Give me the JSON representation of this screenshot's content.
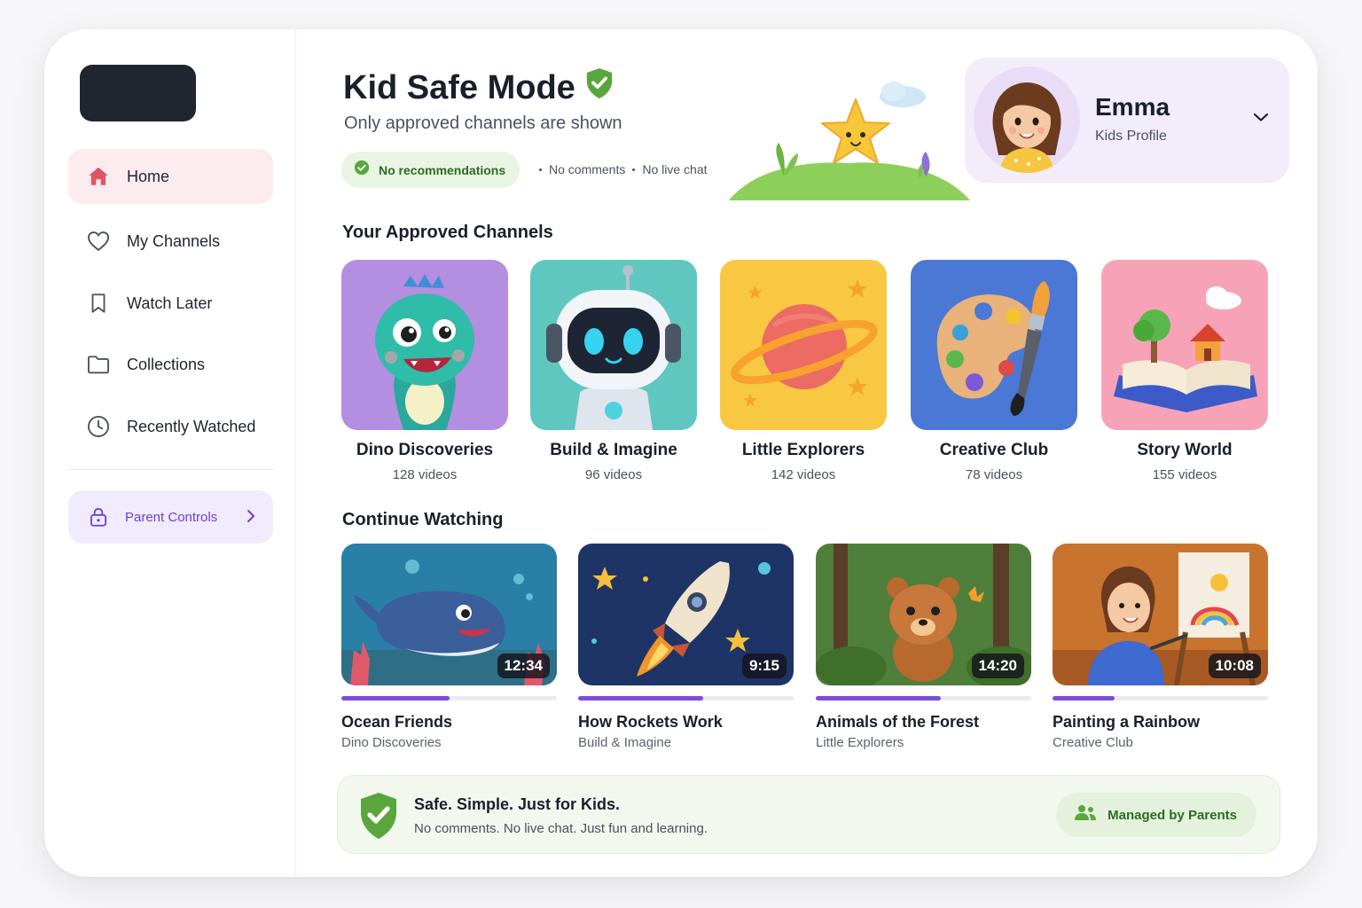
{
  "sidebar": {
    "items": [
      {
        "label": "Home",
        "icon": "home-icon"
      },
      {
        "label": "My Channels",
        "icon": "heart-icon"
      },
      {
        "label": "Watch Later",
        "icon": "bookmark-icon"
      },
      {
        "label": "Collections",
        "icon": "folder-icon"
      },
      {
        "label": "Recently Watched",
        "icon": "clock-icon"
      }
    ],
    "parent_controls_label": "Parent Controls"
  },
  "header": {
    "title": "Kid Safe Mode",
    "subtitle": "Only approved channels are shown",
    "chip_label": "No recommendations",
    "extra_1": "No comments",
    "extra_2": "No live chat"
  },
  "profile": {
    "name": "Emma",
    "type": "Kids Profile"
  },
  "channels": {
    "title": "Your Approved Channels",
    "items": [
      {
        "name": "Dino Discoveries",
        "count": "128 videos",
        "color": "#b48ee0"
      },
      {
        "name": "Build & Imagine",
        "count": "96 videos",
        "color": "#5fc7c0"
      },
      {
        "name": "Little Explorers",
        "count": "142 videos",
        "color": "#f8c842"
      },
      {
        "name": "Creative Club",
        "count": "78 videos",
        "color": "#4a78d4"
      },
      {
        "name": "Story World",
        "count": "155 videos",
        "color": "#f6a3b8"
      }
    ]
  },
  "continue": {
    "title": "Continue Watching",
    "items": [
      {
        "title": "Ocean Friends",
        "channel": "Dino Discoveries",
        "duration": "12:34",
        "progress": 0.5
      },
      {
        "title": "How Rockets Work",
        "channel": "Build & Imagine",
        "duration": "9:15",
        "progress": 0.58
      },
      {
        "title": "Animals of the Forest",
        "channel": "Little Explorers",
        "duration": "14:20",
        "progress": 0.58
      },
      {
        "title": "Painting a Rainbow",
        "channel": "Creative Club",
        "duration": "10:08",
        "progress": 0.29
      }
    ]
  },
  "banner": {
    "title": "Safe. Simple. Just for Kids.",
    "subtitle": "No comments. No live chat. Just fun and learning.",
    "managed_label": "Managed by Parents"
  },
  "colors": {
    "accent": "#7c4ddb",
    "home_active": "#e05565",
    "safe_green": "#5aa63c"
  }
}
